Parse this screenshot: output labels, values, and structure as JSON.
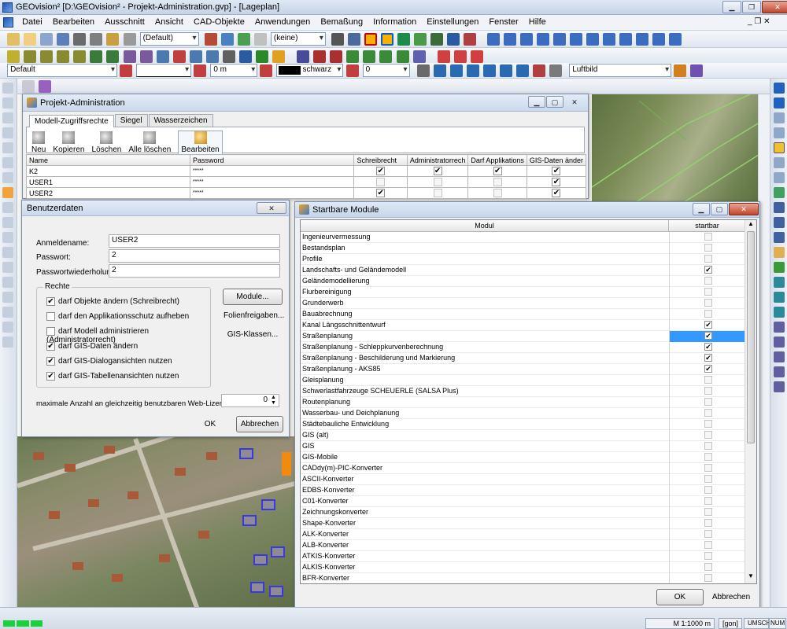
{
  "app": {
    "title": "GEOvision² [D:\\GEOvision² - Projekt-Administration.gvp] - [Lageplan]"
  },
  "menu": [
    "Datei",
    "Bearbeiten",
    "Ausschnitt",
    "Ansicht",
    "CAD-Objekte",
    "Anwendungen",
    "Bemaßung",
    "Information",
    "Einstellungen",
    "Fenster",
    "Hilfe"
  ],
  "toolbar1": {
    "style_combo": "(Default)",
    "layer_combo": "(keine)"
  },
  "toolbar3": {
    "default_combo": "Default",
    "width_value": "0 m",
    "color_name": "schwarz",
    "number_value": "0",
    "view_combo": "Luftbild"
  },
  "projekt": {
    "title": "Projekt-Administration",
    "tabs": [
      "Modell-Zugriffsrechte",
      "Siegel",
      "Wasserzeichen"
    ],
    "buttons": [
      "Neu",
      "Kopieren",
      "Löschen",
      "Alle löschen",
      "Bearbeiten"
    ],
    "columns": [
      "Name",
      "Password",
      "Schreibrecht",
      "Administratorrech",
      "Darf Applikations",
      "GIS-Daten änder"
    ],
    "rows": [
      {
        "name": "K2",
        "password": "*****",
        "flags": [
          true,
          true,
          true,
          true
        ]
      },
      {
        "name": "USER1",
        "password": "*****",
        "flags": [
          false,
          false,
          false,
          true
        ]
      },
      {
        "name": "USER2",
        "password": "*****",
        "flags": [
          true,
          false,
          false,
          true
        ]
      }
    ]
  },
  "benutzer": {
    "title": "Benutzerdaten",
    "anmeldename_label": "Anmeldename:",
    "anmeldename": "USER2",
    "passwort_label": "Passwort:",
    "passwort": "2",
    "wiederholung_label": "Passwortwiederholung:",
    "wiederholung": "2",
    "rechte_label": "Rechte",
    "rechte": [
      {
        "label": "darf Objekte ändern (Schreibrecht)",
        "checked": true
      },
      {
        "label": "darf den Applikationsschutz aufheben",
        "checked": false
      },
      {
        "label": "darf Modell administrieren (Administratorrecht)",
        "checked": false
      },
      {
        "label": "darf GIS-Daten ändern",
        "checked": true
      },
      {
        "label": "darf GIS-Dialogansichten nutzen",
        "checked": true
      },
      {
        "label": "darf GIS-Tabellenansichten nutzen",
        "checked": true
      }
    ],
    "module_button": "Module...",
    "folien_button": "Folienfreigaben...",
    "gis_button": "GIS-Klassen...",
    "lizenzen_label": "maximale Anzahl an gleichzeitig benutzbaren Web-Lizenzen:",
    "lizenzen_value": "0",
    "ok": "OK",
    "abbrechen": "Abbrechen"
  },
  "module": {
    "title": "Startbare Module",
    "col_modul": "Modul",
    "col_startbar": "startbar",
    "selected": "Straßenplanung",
    "items": [
      {
        "name": "Ingenieurvermessung",
        "checked": false
      },
      {
        "name": "Bestandsplan",
        "checked": false
      },
      {
        "name": "Profile",
        "checked": false
      },
      {
        "name": "Landschafts- und Geländemodell",
        "checked": true
      },
      {
        "name": "Geländemodellierung",
        "checked": false
      },
      {
        "name": "Flurbereinigung",
        "checked": false
      },
      {
        "name": "Grunderwerb",
        "checked": false
      },
      {
        "name": "Bauabrechnung",
        "checked": false
      },
      {
        "name": "Kanal Längsschnittentwurf",
        "checked": true
      },
      {
        "name": "Straßenplanung",
        "checked": true
      },
      {
        "name": "Straßenplanung - Schleppkurvenberechnung",
        "checked": true
      },
      {
        "name": "Straßenplanung - Beschilderung und Markierung",
        "checked": true
      },
      {
        "name": "Straßenplanung - AKS85",
        "checked": true
      },
      {
        "name": "Gleisplanung",
        "checked": false
      },
      {
        "name": "Schwerlastfahrzeuge SCHEUERLE (SALSA Plus)",
        "checked": false
      },
      {
        "name": "Routenplanung",
        "checked": false
      },
      {
        "name": "Wasserbau- und Deichplanung",
        "checked": false
      },
      {
        "name": "Städtebauliche Entwicklung",
        "checked": false
      },
      {
        "name": "GIS (alt)",
        "checked": false
      },
      {
        "name": "GIS",
        "checked": false
      },
      {
        "name": "GIS-Mobile",
        "checked": false
      },
      {
        "name": "CADdy(m)-PIC-Konverter",
        "checked": false
      },
      {
        "name": "ASCII-Konverter",
        "checked": false
      },
      {
        "name": "EDBS-Konverter",
        "checked": false
      },
      {
        "name": "C01-Konverter",
        "checked": false
      },
      {
        "name": "Zeichnungskonverter",
        "checked": false
      },
      {
        "name": "Shape-Konverter",
        "checked": false
      },
      {
        "name": "ALK-Konverter",
        "checked": false
      },
      {
        "name": "ALB-Konverter",
        "checked": false
      },
      {
        "name": "ATKIS-Konverter",
        "checked": false
      },
      {
        "name": "ALKIS-Konverter",
        "checked": false
      },
      {
        "name": "BFR-Konverter",
        "checked": false
      }
    ],
    "ok": "OK",
    "abbrechen": "Abbrechen"
  },
  "status": {
    "scale": "M 1:1000 m",
    "unit": "[gon]",
    "umsch": "UMSCH",
    "num": "NUM"
  }
}
